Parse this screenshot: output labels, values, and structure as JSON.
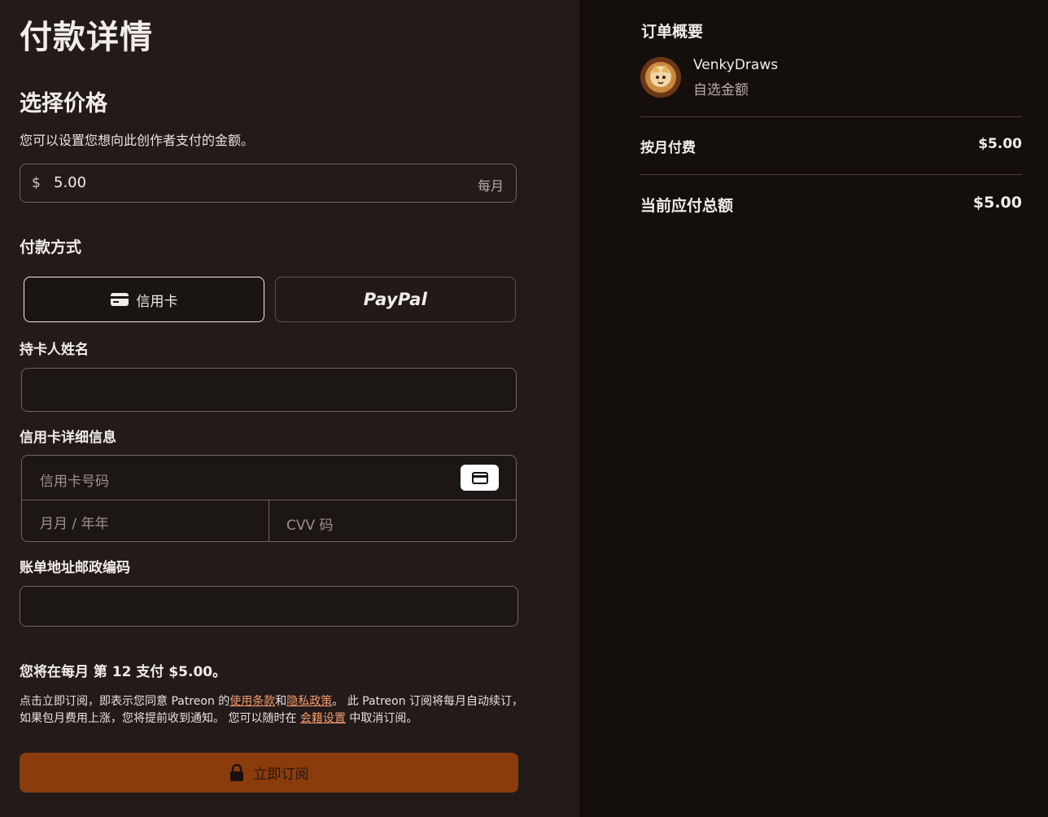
{
  "page_title": "付款详情",
  "price_section": {
    "title": "选择价格",
    "subtitle": "您可以设置您想向此创作者支付的金额。",
    "currency_symbol": "$",
    "amount": "5.00",
    "period": "每月"
  },
  "payment_method": {
    "title": "付款方式",
    "card_label": "信用卡",
    "paypal_label": "PayPal"
  },
  "cardholder": {
    "label": "持卡人姓名",
    "value": ""
  },
  "card_details": {
    "label": "信用卡详细信息",
    "number_placeholder": "信用卡号码",
    "expiry_placeholder": "月月 / 年年",
    "cvv_placeholder": "CVV 码"
  },
  "postal": {
    "label": "账单地址邮政编码",
    "value": ""
  },
  "billing_note": "您将在每月 第 12 支付 $5.00。",
  "terms": {
    "part1": "点击立即订阅，即表示您同意 Patreon 的",
    "terms_link": "使用条款",
    "and": "和",
    "privacy_link": "隐私政策",
    "part2": "。 此 Patreon 订阅将每月自动续订，如果包月费用上涨，您将提前收到通知。 您可以随时在 ",
    "membership_link": "会籍设置",
    "part3": " 中取消订阅。"
  },
  "submit_label": "立即订阅",
  "summary": {
    "title": "订单概要",
    "creator_name": "VenkyDraws",
    "creator_tier": "自选金额",
    "monthly_label": "按月付费",
    "monthly_value": "$5.00",
    "total_label": "当前应付总额",
    "total_value": "$5.00"
  },
  "colors": {
    "left_bg": "#221b19",
    "right_bg": "#140e0d",
    "accent_button": "#8a3c0c",
    "link": "#f49a6c"
  }
}
